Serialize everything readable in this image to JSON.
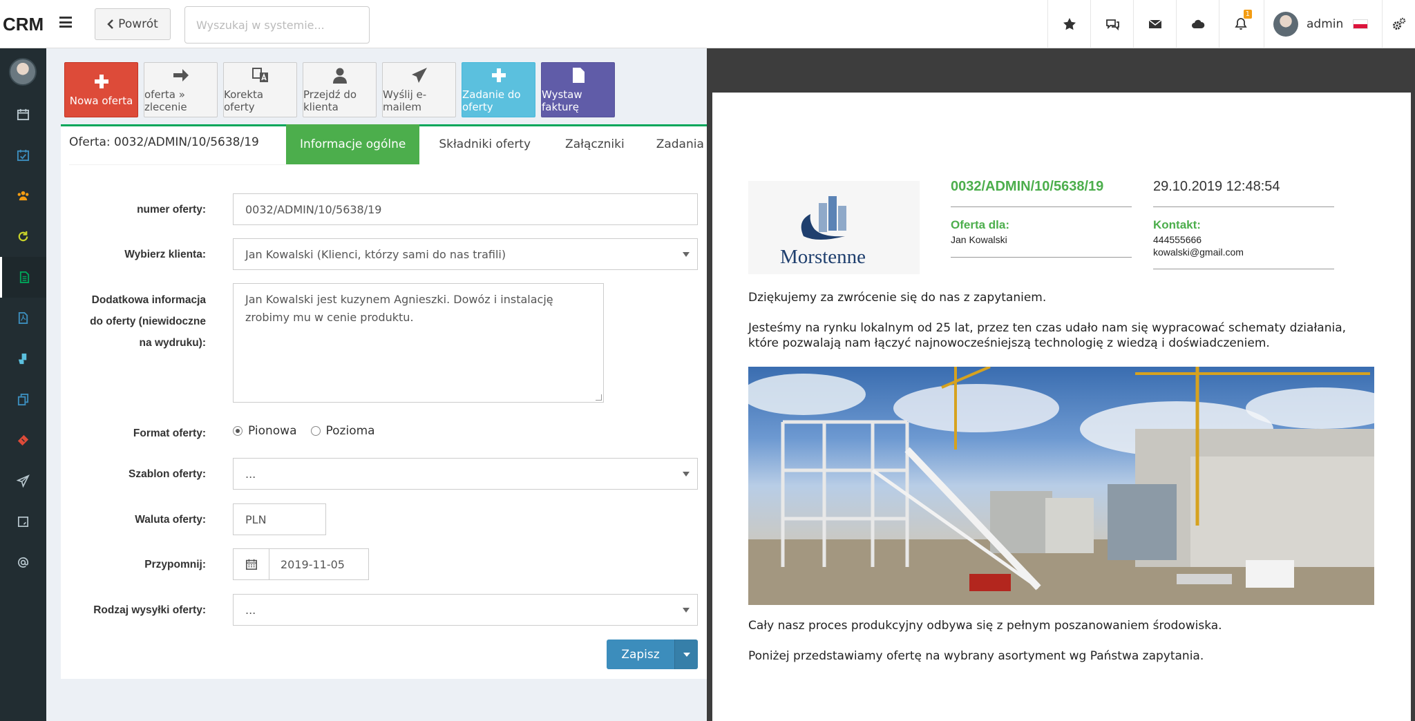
{
  "topbar": {
    "brand": "CRM",
    "back_label": "Powrót",
    "search_placeholder": "Wyszukaj w systemie...",
    "notifications_badge": "1",
    "username": "admin"
  },
  "toolbar": {
    "buttons": [
      {
        "label": "Nowa oferta",
        "icon": "plus-icon"
      },
      {
        "label": "oferta » zlecenie",
        "icon": "arrow-right-icon"
      },
      {
        "label": "Korekta oferty",
        "icon": "translate-icon"
      },
      {
        "label": "Przejdź do klienta",
        "icon": "user-icon"
      },
      {
        "label": "Wyślij e-mailem",
        "icon": "paper-plane-icon"
      },
      {
        "label": "Zadanie do oferty",
        "icon": "plus-icon"
      },
      {
        "label": "Wystaw fakturę",
        "icon": "file-icon"
      }
    ]
  },
  "offer": {
    "title": "Oferta: 0032/ADMIN/10/5638/19",
    "tabs": [
      "Informacje ogólne",
      "Składniki oferty",
      "Załączniki",
      "Zadania"
    ]
  },
  "form": {
    "number_label": "numer oferty:",
    "number_value": "0032/ADMIN/10/5638/19",
    "client_label": "Wybierz klienta:",
    "client_value": "Jan Kowalski (Klienci, którzy sami do nas trafili)",
    "info_label_1": "Dodatkowa informacja",
    "info_label_2": "do oferty (niewidoczne",
    "info_label_3": "na wydruku):",
    "info_value": "Jan Kowalski jest kuzynem Agnieszki. Dowóz i instalację zrobimy mu w cenie produktu.",
    "format_label": "Format oferty:",
    "format_portrait": "Pionowa",
    "format_landscape": "Pozioma",
    "template_label": "Szablon oferty:",
    "template_value": "...",
    "currency_label": "Waluta oferty:",
    "currency_value": "PLN",
    "remind_label": "Przypomnij:",
    "remind_value": "2019-11-05",
    "shipping_label": "Rodzaj wysyłki oferty:",
    "shipping_value": "...",
    "save_label": "Zapisz"
  },
  "preview": {
    "logo_text": "Morstenne",
    "number": "0032/ADMIN/10/5638/19",
    "datetime": "29.10.2019 12:48:54",
    "for_label": "Oferta dla:",
    "for_name": "Jan Kowalski",
    "contact_label": "Kontakt:",
    "contact_phone": "444555666",
    "contact_email": "kowalski@gmail.com",
    "para1": "Dziękujemy za zwrócenie się do nas z zapytaniem.",
    "para2": "Jesteśmy na rynku lokalnym od 25 lat, przez ten czas udało nam się wypracować schematy działania, które pozwalają nam łączyć najnowocześniejszą technologię z wiedzą i doświadczeniem.",
    "para3": "Cały nasz proces produkcyjny odbywa się z pełnym poszanowaniem środowiska.",
    "para4": "Poniżej przedstawiamy ofertę na wybrany asortyment wg Państwa zapytania."
  },
  "colors": {
    "green": "#4cae4c",
    "blue": "#3c8dbc",
    "sidebar": "#222d32"
  }
}
